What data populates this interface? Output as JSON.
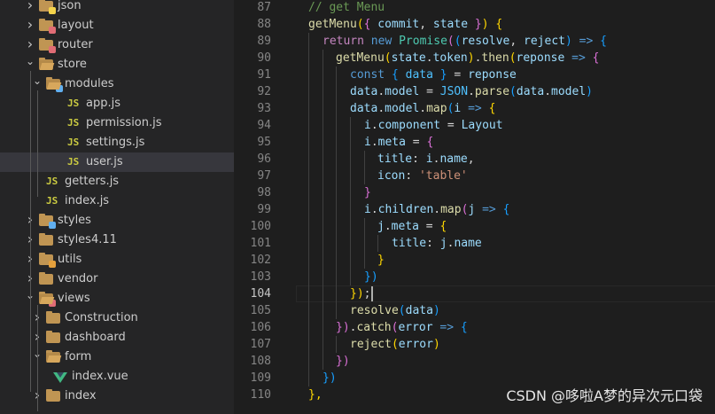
{
  "explorer": {
    "items": [
      {
        "label": "json",
        "kind": "folder",
        "depth": 1,
        "expanded": false,
        "icon": "json-folder-icon",
        "badge": "#f3d34b"
      },
      {
        "label": "layout",
        "kind": "folder",
        "depth": 1,
        "expanded": false,
        "icon": "layout-folder-icon",
        "badge": "#e06c75"
      },
      {
        "label": "router",
        "kind": "folder",
        "depth": 1,
        "expanded": false,
        "icon": "router-folder-icon",
        "badge": "#e06c75"
      },
      {
        "label": "store",
        "kind": "folder",
        "depth": 1,
        "expanded": true,
        "icon": "store-folder-icon"
      },
      {
        "label": "modules",
        "kind": "folder",
        "depth": 2,
        "expanded": true,
        "icon": "modules-folder-icon",
        "badge": "#61afef"
      },
      {
        "label": "app.js",
        "kind": "js",
        "depth": 3,
        "icon": "js-file-icon"
      },
      {
        "label": "permission.js",
        "kind": "js",
        "depth": 3,
        "icon": "js-file-icon"
      },
      {
        "label": "settings.js",
        "kind": "js",
        "depth": 3,
        "icon": "js-file-icon"
      },
      {
        "label": "user.js",
        "kind": "js",
        "depth": 3,
        "icon": "js-file-icon",
        "selected": true
      },
      {
        "label": "getters.js",
        "kind": "js",
        "depth": 2,
        "icon": "js-file-icon"
      },
      {
        "label": "index.js",
        "kind": "js",
        "depth": 2,
        "icon": "js-file-icon"
      },
      {
        "label": "styles",
        "kind": "folder",
        "depth": 1,
        "expanded": false,
        "icon": "styles-folder-icon",
        "badge": "#61afef"
      },
      {
        "label": "styles4.11",
        "kind": "folder",
        "depth": 1,
        "expanded": false,
        "icon": "folder-icon"
      },
      {
        "label": "utils",
        "kind": "folder",
        "depth": 1,
        "expanded": false,
        "icon": "utils-folder-icon",
        "badge": "#e5a03c"
      },
      {
        "label": "vendor",
        "kind": "folder",
        "depth": 1,
        "expanded": false,
        "icon": "folder-icon"
      },
      {
        "label": "views",
        "kind": "folder",
        "depth": 1,
        "expanded": true,
        "icon": "views-folder-icon",
        "badge": "#e06c75"
      },
      {
        "label": "Construction",
        "kind": "folder",
        "depth": 2,
        "expanded": false,
        "icon": "folder-icon"
      },
      {
        "label": "dashboard",
        "kind": "folder",
        "depth": 2,
        "expanded": false,
        "icon": "folder-icon"
      },
      {
        "label": "form",
        "kind": "folder",
        "depth": 2,
        "expanded": true,
        "icon": "folder-icon"
      },
      {
        "label": "index.vue",
        "kind": "vue",
        "depth": 3,
        "icon": "vue-file-icon"
      },
      {
        "label": "index",
        "kind": "folder",
        "depth": 2,
        "expanded": false,
        "icon": "folder-icon"
      }
    ]
  },
  "editor": {
    "active_line": 104,
    "lines": [
      {
        "n": "87",
        "indent": 1,
        "tokens": [
          [
            "// get Menu",
            "cmt"
          ]
        ]
      },
      {
        "n": "88",
        "indent": 1,
        "tokens": [
          [
            "getMenu",
            "fn"
          ],
          [
            "(",
            "b1"
          ],
          [
            "{ ",
            "b2"
          ],
          [
            "commit",
            "var"
          ],
          [
            ", ",
            "pun"
          ],
          [
            "state",
            "var"
          ],
          [
            " }",
            "b2"
          ],
          [
            ") ",
            "b1"
          ],
          [
            "{",
            "b1"
          ]
        ]
      },
      {
        "n": "89",
        "indent": 2,
        "tokens": [
          [
            "return ",
            "ctl"
          ],
          [
            "new ",
            "kw"
          ],
          [
            "Promise",
            "cls"
          ],
          [
            "(",
            "b2"
          ],
          [
            "(",
            "b3"
          ],
          [
            "resolve",
            "var"
          ],
          [
            ", ",
            "pun"
          ],
          [
            "reject",
            "var"
          ],
          [
            ") ",
            "b3"
          ],
          [
            "=> ",
            "kw"
          ],
          [
            "{",
            "b3"
          ]
        ]
      },
      {
        "n": "90",
        "indent": 3,
        "tokens": [
          [
            "getMenu",
            "fn"
          ],
          [
            "(",
            "b1"
          ],
          [
            "state",
            "var"
          ],
          [
            ".",
            "pun"
          ],
          [
            "token",
            "var"
          ],
          [
            ")",
            "b1"
          ],
          [
            ".",
            "pun"
          ],
          [
            "then",
            "fn"
          ],
          [
            "(",
            "b1"
          ],
          [
            "reponse",
            "var"
          ],
          [
            " => ",
            "kw"
          ],
          [
            "{",
            "b2"
          ]
        ]
      },
      {
        "n": "91",
        "indent": 4,
        "tokens": [
          [
            "const ",
            "kw"
          ],
          [
            "{ ",
            "b3"
          ],
          [
            "data",
            "cst"
          ],
          [
            " }",
            "b3"
          ],
          [
            " = ",
            "pun"
          ],
          [
            "reponse",
            "var"
          ]
        ]
      },
      {
        "n": "92",
        "indent": 4,
        "tokens": [
          [
            "data",
            "var"
          ],
          [
            ".",
            "pun"
          ],
          [
            "model",
            "var"
          ],
          [
            " = ",
            "pun"
          ],
          [
            "JSON",
            "cst"
          ],
          [
            ".",
            "pun"
          ],
          [
            "parse",
            "fn"
          ],
          [
            "(",
            "b3"
          ],
          [
            "data",
            "var"
          ],
          [
            ".",
            "pun"
          ],
          [
            "model",
            "var"
          ],
          [
            ")",
            "b3"
          ]
        ]
      },
      {
        "n": "93",
        "indent": 4,
        "tokens": [
          [
            "data",
            "var"
          ],
          [
            ".",
            "pun"
          ],
          [
            "model",
            "var"
          ],
          [
            ".",
            "pun"
          ],
          [
            "map",
            "fn"
          ],
          [
            "(",
            "b3"
          ],
          [
            "i",
            "var"
          ],
          [
            " => ",
            "kw"
          ],
          [
            "{",
            "b1"
          ]
        ]
      },
      {
        "n": "94",
        "indent": 5,
        "tokens": [
          [
            "i",
            "var"
          ],
          [
            ".",
            "pun"
          ],
          [
            "component",
            "var"
          ],
          [
            " = ",
            "pun"
          ],
          [
            "Layout",
            "var"
          ]
        ]
      },
      {
        "n": "95",
        "indent": 5,
        "tokens": [
          [
            "i",
            "var"
          ],
          [
            ".",
            "pun"
          ],
          [
            "meta",
            "var"
          ],
          [
            " = ",
            "pun"
          ],
          [
            "{",
            "b2"
          ]
        ]
      },
      {
        "n": "96",
        "indent": 6,
        "tokens": [
          [
            "title",
            "var"
          ],
          [
            ": ",
            "pun"
          ],
          [
            "i",
            "var"
          ],
          [
            ".",
            "pun"
          ],
          [
            "name",
            "var"
          ],
          [
            ",",
            "pun"
          ]
        ]
      },
      {
        "n": "97",
        "indent": 6,
        "tokens": [
          [
            "icon",
            "var"
          ],
          [
            ": ",
            "pun"
          ],
          [
            "'table'",
            "str"
          ]
        ]
      },
      {
        "n": "98",
        "indent": 5,
        "tokens": [
          [
            "}",
            "b2"
          ]
        ]
      },
      {
        "n": "99",
        "indent": 5,
        "tokens": [
          [
            "i",
            "var"
          ],
          [
            ".",
            "pun"
          ],
          [
            "children",
            "var"
          ],
          [
            ".",
            "pun"
          ],
          [
            "map",
            "fn"
          ],
          [
            "(",
            "b2"
          ],
          [
            "j",
            "var"
          ],
          [
            " => ",
            "kw"
          ],
          [
            "{",
            "b3"
          ]
        ]
      },
      {
        "n": "100",
        "indent": 6,
        "tokens": [
          [
            "j",
            "var"
          ],
          [
            ".",
            "pun"
          ],
          [
            "meta",
            "var"
          ],
          [
            " = ",
            "pun"
          ],
          [
            "{",
            "b1"
          ]
        ]
      },
      {
        "n": "101",
        "indent": 7,
        "tokens": [
          [
            "title",
            "var"
          ],
          [
            ": ",
            "pun"
          ],
          [
            "j",
            "var"
          ],
          [
            ".",
            "pun"
          ],
          [
            "name",
            "var"
          ]
        ]
      },
      {
        "n": "102",
        "indent": 6,
        "tokens": [
          [
            "}",
            "b1"
          ]
        ]
      },
      {
        "n": "103",
        "indent": 5,
        "tokens": [
          [
            "})",
            "b3"
          ]
        ]
      },
      {
        "n": "104",
        "indent": 4,
        "tokens": [
          [
            "})",
            "b1"
          ],
          [
            ";",
            "pun"
          ]
        ]
      },
      {
        "n": "105",
        "indent": 4,
        "tokens": [
          [
            "resolve",
            "fn"
          ],
          [
            "(",
            "b3"
          ],
          [
            "data",
            "var"
          ],
          [
            ")",
            "b3"
          ]
        ]
      },
      {
        "n": "106",
        "indent": 3,
        "tokens": [
          [
            "})",
            "b2"
          ],
          [
            ".",
            "pun"
          ],
          [
            "catch",
            "fn"
          ],
          [
            "(",
            "b2"
          ],
          [
            "error",
            "var"
          ],
          [
            " => ",
            "kw"
          ],
          [
            "{",
            "b3"
          ]
        ]
      },
      {
        "n": "107",
        "indent": 4,
        "tokens": [
          [
            "reject",
            "fn"
          ],
          [
            "(",
            "b1"
          ],
          [
            "error",
            "var"
          ],
          [
            ")",
            "b1"
          ]
        ]
      },
      {
        "n": "108",
        "indent": 3,
        "tokens": [
          [
            "})",
            "b2"
          ]
        ]
      },
      {
        "n": "109",
        "indent": 2,
        "tokens": [
          [
            "})",
            "b3"
          ]
        ]
      },
      {
        "n": "110",
        "indent": 1,
        "tokens": [
          [
            "},",
            "b1"
          ]
        ]
      }
    ]
  },
  "watermark": "CSDN @哆啦A梦的异次元口袋"
}
